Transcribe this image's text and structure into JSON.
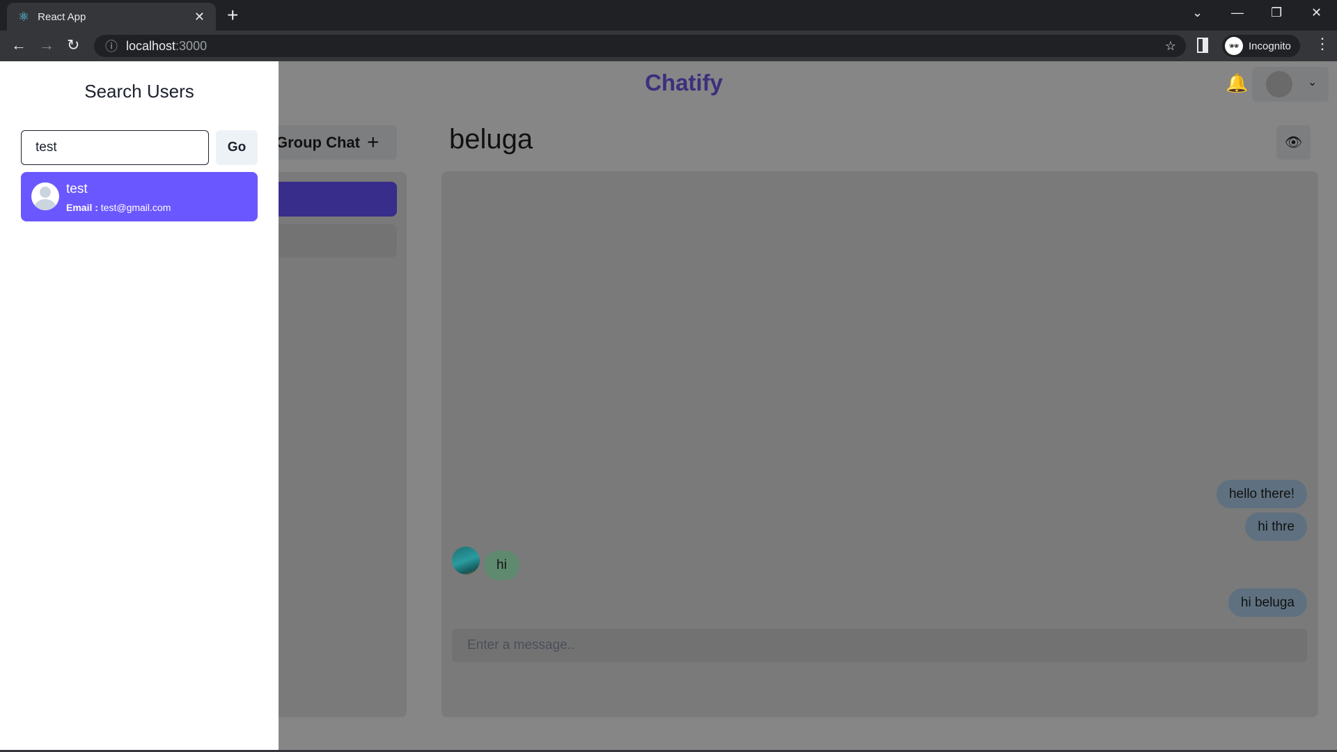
{
  "browser": {
    "tab_title": "React App",
    "url_host": "localhost",
    "url_port": ":3000",
    "profile_label": "Incognito"
  },
  "header": {
    "brand": "Chatify"
  },
  "sidebar": {
    "group_chat_label": "Group Chat"
  },
  "chat": {
    "title": "beluga",
    "input_placeholder": "Enter a message..",
    "messages": [
      {
        "text": "hello there!",
        "side": "sent"
      },
      {
        "text": "hi thre",
        "side": "sent"
      },
      {
        "text": "hi",
        "side": "received"
      },
      {
        "text": "hi beluga",
        "side": "sent"
      }
    ]
  },
  "drawer": {
    "title": "Search Users",
    "search_value": "test",
    "go_label": "Go",
    "results": [
      {
        "name": "test",
        "email_label": "Email :",
        "email": "test@gmail.com"
      }
    ]
  },
  "colors": {
    "accent": "#6b57ff",
    "sent_bubble": "#bee3f8",
    "received_bubble": "#b9f5d0"
  }
}
